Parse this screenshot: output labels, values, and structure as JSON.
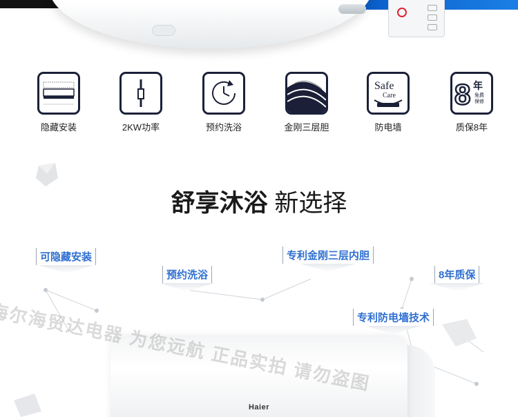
{
  "features": [
    {
      "icon": "hidden-install-icon",
      "label": "隐藏安装"
    },
    {
      "icon": "power-2kw-icon",
      "label": "2KW功率"
    },
    {
      "icon": "timer-clock-icon",
      "label": "预约洗浴"
    },
    {
      "icon": "triple-tank-icon",
      "label": "金刚三层胆"
    },
    {
      "icon": "safe-care-icon",
      "label": "防电墙",
      "icon_text": [
        "Safe",
        "Care"
      ]
    },
    {
      "icon": "warranty-8-year-icon",
      "label": "质保8年",
      "icon_text": [
        "8",
        "年",
        "免费",
        "保修"
      ]
    }
  ],
  "headline": {
    "bold": "舒享沐浴",
    "thin": "新选择"
  },
  "tags": [
    "可隐藏安装",
    "预约洗浴",
    "专利金刚三层内胆",
    "8年质保",
    "专利防电墙技术"
  ],
  "watermark": "海尔海贸达电器 为您远航 正品实拍 请勿盗图",
  "brand": "Haier",
  "colors": {
    "tag_text": "#2f6fd0",
    "icon_border": "#1b2038"
  }
}
